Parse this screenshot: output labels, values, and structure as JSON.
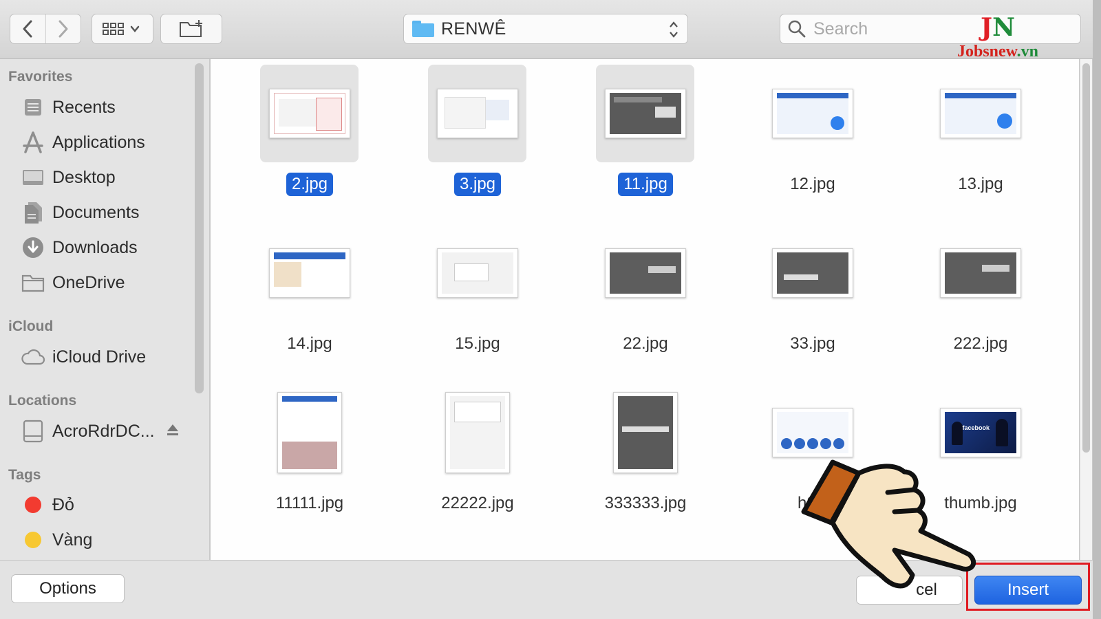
{
  "toolbar": {
    "back_icon": "chevron-left-icon",
    "forward_icon": "chevron-right-icon",
    "view_icon": "icon-grid-view-icon",
    "new_folder_icon": "new-folder-icon",
    "location": "RENWÊ",
    "search_placeholder": "Search"
  },
  "watermark": {
    "mark_j": "J",
    "mark_n": "N",
    "site": "Jobsnew",
    "site_tld": ".vn"
  },
  "sidebar": {
    "favorites_header": "Favorites",
    "favorites": [
      {
        "label": "Recents",
        "icon": "recents-icon"
      },
      {
        "label": "Applications",
        "icon": "applications-icon"
      },
      {
        "label": "Desktop",
        "icon": "desktop-icon"
      },
      {
        "label": "Documents",
        "icon": "documents-icon"
      },
      {
        "label": "Downloads",
        "icon": "downloads-icon"
      },
      {
        "label": "OneDrive",
        "icon": "folder-icon"
      }
    ],
    "icloud_header": "iCloud",
    "icloud": [
      {
        "label": "iCloud Drive",
        "icon": "cloud-icon"
      }
    ],
    "locations_header": "Locations",
    "locations": [
      {
        "label": "AcroRdrDC...",
        "icon": "disk-icon",
        "eject_icon": "eject-icon"
      }
    ],
    "tags_header": "Tags",
    "tags": [
      {
        "label": "Đỏ",
        "color": "#f23b30"
      },
      {
        "label": "Vàng",
        "color": "#f7c832"
      }
    ]
  },
  "files": [
    {
      "name": "2.jpg",
      "selected": true
    },
    {
      "name": "3.jpg",
      "selected": true
    },
    {
      "name": "11.jpg",
      "selected": true
    },
    {
      "name": "12.jpg",
      "selected": false
    },
    {
      "name": "13.jpg",
      "selected": false
    },
    {
      "name": "14.jpg",
      "selected": false
    },
    {
      "name": "15.jpg",
      "selected": false
    },
    {
      "name": "22.jpg",
      "selected": false
    },
    {
      "name": "33.jpg",
      "selected": false
    },
    {
      "name": "222.jpg",
      "selected": false
    },
    {
      "name": "11111.jpg",
      "selected": false
    },
    {
      "name": "22222.jpg",
      "selected": false
    },
    {
      "name": "333333.jpg",
      "selected": false
    },
    {
      "name": "h2",
      "selected": false
    },
    {
      "name": "thumb.jpg",
      "selected": false
    }
  ],
  "thumbnail_text": {
    "facebook": "facebook"
  },
  "footer": {
    "options_label": "Options",
    "cancel_label": "cel",
    "insert_label": "Insert"
  },
  "colors": {
    "selection": "#1e63d7",
    "insert_button": "#2a72ea",
    "highlight_box": "#e01b22"
  }
}
